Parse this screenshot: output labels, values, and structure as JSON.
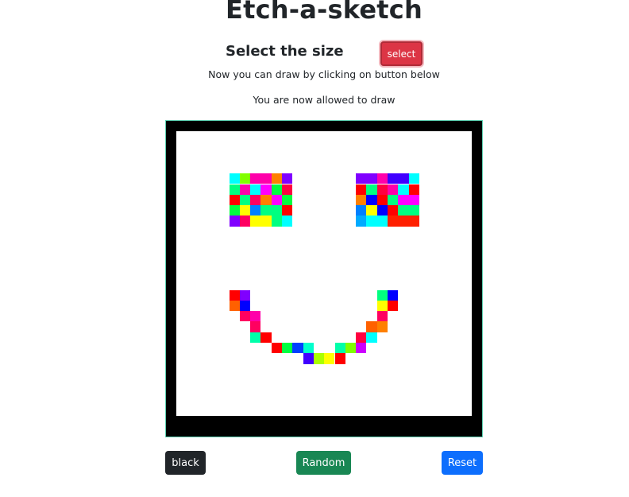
{
  "header": {
    "title": "Etch-a-sketch",
    "size_label": "Select the size",
    "select_button": "select",
    "instruction": "Now you can draw by clicking on button below",
    "status": "You are now allowed to draw"
  },
  "controls": {
    "black_button": "black",
    "random_button": "Random",
    "reset_button": "Reset"
  },
  "colors": {
    "canvas_border": "#000000",
    "canvas_background": "#ffffff",
    "select_button": "#dc3545",
    "black_button": "#212529",
    "random_button": "#198754",
    "reset_button": "#0d6efd"
  },
  "grid": {
    "columns": 28,
    "rows": 27,
    "painted_cells": [
      {
        "col": 5,
        "row": 4,
        "color": "#00ffff"
      },
      {
        "col": 6,
        "row": 4,
        "color": "#80ff00"
      },
      {
        "col": 7,
        "row": 4,
        "color": "#ff00aa"
      },
      {
        "col": 8,
        "row": 4,
        "color": "#ff00aa"
      },
      {
        "col": 9,
        "row": 4,
        "color": "#ff8000"
      },
      {
        "col": 10,
        "row": 4,
        "color": "#8000ff"
      },
      {
        "col": 5,
        "row": 5,
        "color": "#00ff80"
      },
      {
        "col": 6,
        "row": 5,
        "color": "#ff00aa"
      },
      {
        "col": 7,
        "row": 5,
        "color": "#00ffff"
      },
      {
        "col": 8,
        "row": 5,
        "color": "#ff00ff"
      },
      {
        "col": 9,
        "row": 5,
        "color": "#00ff40"
      },
      {
        "col": 10,
        "row": 5,
        "color": "#ff0040"
      },
      {
        "col": 5,
        "row": 6,
        "color": "#ff0000"
      },
      {
        "col": 6,
        "row": 6,
        "color": "#00ff80"
      },
      {
        "col": 7,
        "row": 6,
        "color": "#ff0060"
      },
      {
        "col": 8,
        "row": 6,
        "color": "#ff8000"
      },
      {
        "col": 9,
        "row": 6,
        "color": "#ff00ff"
      },
      {
        "col": 10,
        "row": 6,
        "color": "#00ff40"
      },
      {
        "col": 5,
        "row": 7,
        "color": "#00ff40"
      },
      {
        "col": 6,
        "row": 7,
        "color": "#ffff00"
      },
      {
        "col": 7,
        "row": 7,
        "color": "#0080ff"
      },
      {
        "col": 8,
        "row": 7,
        "color": "#00ff80"
      },
      {
        "col": 9,
        "row": 7,
        "color": "#00ff80"
      },
      {
        "col": 10,
        "row": 7,
        "color": "#ff0000"
      },
      {
        "col": 5,
        "row": 8,
        "color": "#8000ff"
      },
      {
        "col": 6,
        "row": 8,
        "color": "#ff0060"
      },
      {
        "col": 7,
        "row": 8,
        "color": "#ffff00"
      },
      {
        "col": 8,
        "row": 8,
        "color": "#ffff00"
      },
      {
        "col": 9,
        "row": 8,
        "color": "#00ff80"
      },
      {
        "col": 10,
        "row": 8,
        "color": "#00ffff"
      },
      {
        "col": 17,
        "row": 4,
        "color": "#8000ff"
      },
      {
        "col": 18,
        "row": 4,
        "color": "#8000ff"
      },
      {
        "col": 19,
        "row": 4,
        "color": "#ff00aa"
      },
      {
        "col": 20,
        "row": 4,
        "color": "#4000ff"
      },
      {
        "col": 21,
        "row": 4,
        "color": "#4000ff"
      },
      {
        "col": 22,
        "row": 4,
        "color": "#00ffff"
      },
      {
        "col": 17,
        "row": 5,
        "color": "#ff0000"
      },
      {
        "col": 18,
        "row": 5,
        "color": "#00ff80"
      },
      {
        "col": 19,
        "row": 5,
        "color": "#ff0040"
      },
      {
        "col": 20,
        "row": 5,
        "color": "#ff00aa"
      },
      {
        "col": 21,
        "row": 5,
        "color": "#00ffff"
      },
      {
        "col": 22,
        "row": 5,
        "color": "#ff0000"
      },
      {
        "col": 17,
        "row": 6,
        "color": "#ff8000"
      },
      {
        "col": 18,
        "row": 6,
        "color": "#0000ff"
      },
      {
        "col": 19,
        "row": 6,
        "color": "#ff0000"
      },
      {
        "col": 20,
        "row": 6,
        "color": "#00ff80"
      },
      {
        "col": 21,
        "row": 6,
        "color": "#ff00ff"
      },
      {
        "col": 22,
        "row": 6,
        "color": "#ff00ff"
      },
      {
        "col": 17,
        "row": 7,
        "color": "#0080ff"
      },
      {
        "col": 18,
        "row": 7,
        "color": "#ffff00"
      },
      {
        "col": 19,
        "row": 7,
        "color": "#0000ff"
      },
      {
        "col": 20,
        "row": 7,
        "color": "#ff0000"
      },
      {
        "col": 21,
        "row": 7,
        "color": "#00ff80"
      },
      {
        "col": 22,
        "row": 7,
        "color": "#00ff80"
      },
      {
        "col": 17,
        "row": 8,
        "color": "#00aaff"
      },
      {
        "col": 18,
        "row": 8,
        "color": "#00ffff"
      },
      {
        "col": 19,
        "row": 8,
        "color": "#00ffff"
      },
      {
        "col": 20,
        "row": 8,
        "color": "#ff2000"
      },
      {
        "col": 21,
        "row": 8,
        "color": "#ff2000"
      },
      {
        "col": 22,
        "row": 8,
        "color": "#ff2000"
      },
      {
        "col": 5,
        "row": 15,
        "color": "#ff0000"
      },
      {
        "col": 6,
        "row": 15,
        "color": "#8000ff"
      },
      {
        "col": 5,
        "row": 16,
        "color": "#ff6000"
      },
      {
        "col": 6,
        "row": 16,
        "color": "#0000ff"
      },
      {
        "col": 6,
        "row": 17,
        "color": "#ff0060"
      },
      {
        "col": 7,
        "row": 17,
        "color": "#ff00aa"
      },
      {
        "col": 7,
        "row": 18,
        "color": "#ff0060"
      },
      {
        "col": 7,
        "row": 19,
        "color": "#00ffaa"
      },
      {
        "col": 8,
        "row": 19,
        "color": "#ff0000"
      },
      {
        "col": 9,
        "row": 20,
        "color": "#ff0000"
      },
      {
        "col": 10,
        "row": 20,
        "color": "#00ff40"
      },
      {
        "col": 11,
        "row": 20,
        "color": "#0040ff"
      },
      {
        "col": 12,
        "row": 20,
        "color": "#00ffcc"
      },
      {
        "col": 12,
        "row": 21,
        "color": "#4000ff"
      },
      {
        "col": 13,
        "row": 21,
        "color": "#aaff00"
      },
      {
        "col": 14,
        "row": 21,
        "color": "#ffff00"
      },
      {
        "col": 15,
        "row": 21,
        "color": "#ff0000"
      },
      {
        "col": 15,
        "row": 20,
        "color": "#00ffaa"
      },
      {
        "col": 16,
        "row": 20,
        "color": "#80ff00"
      },
      {
        "col": 17,
        "row": 20,
        "color": "#cc00ff"
      },
      {
        "col": 17,
        "row": 19,
        "color": "#ff0040"
      },
      {
        "col": 18,
        "row": 19,
        "color": "#00ffff"
      },
      {
        "col": 18,
        "row": 18,
        "color": "#ff6000"
      },
      {
        "col": 19,
        "row": 18,
        "color": "#ff8000"
      },
      {
        "col": 19,
        "row": 17,
        "color": "#ff0060"
      },
      {
        "col": 19,
        "row": 16,
        "color": "#ffff00"
      },
      {
        "col": 20,
        "row": 16,
        "color": "#ff0000"
      },
      {
        "col": 19,
        "row": 15,
        "color": "#00ff80"
      },
      {
        "col": 20,
        "row": 15,
        "color": "#0000ff"
      }
    ]
  }
}
